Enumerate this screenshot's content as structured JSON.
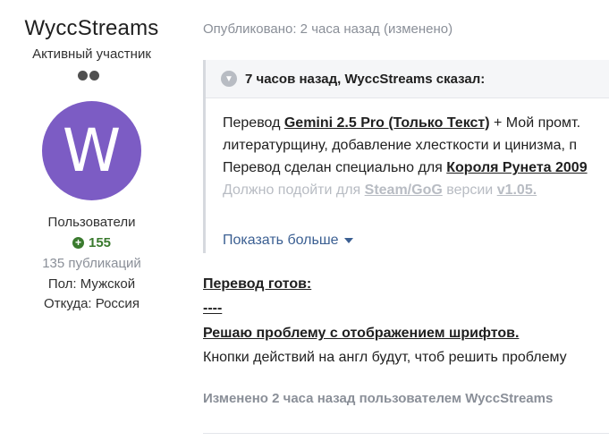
{
  "author": {
    "username": "WyccStreams",
    "rank": "Активный участник",
    "avatar_letter": "W",
    "avatar_color": "#7c5cc4",
    "group": "Пользователи",
    "reputation": "155",
    "posts": "135 публикаций",
    "gender": "Пол: Мужской",
    "location": "Откуда: Россия"
  },
  "post": {
    "meta": "Опубликовано: 2 часа назад (изменено)",
    "quote": {
      "header": "7 часов назад, WyccStreams сказал:",
      "line1_prefix": "Перевод ",
      "line1_bold": "Gemini 2.5 Pro (Только Текст)",
      "line1_suffix": " + Мой промт.",
      "line2": "литературщину, добавление хлесткости и цинизма, п",
      "line3_prefix": "Перевод сделан специально для ",
      "line3_bold": "Короля Рунета 2009",
      "line4_prefix": "Должно подойти для ",
      "line4_bold1": "Steam/GoG",
      "line4_mid": " версии ",
      "line4_bold2": "v1.05.",
      "show_more": "Показать больше"
    },
    "line_ready": "Перевод готов:",
    "line_dashes": "----",
    "line_fonts": "Решаю проблему с отображением шрифтов.",
    "line_buttons": "Кнопки действий на англ будут, чтоб решить проблему",
    "edited": "Изменено 2 часа назад пользователем WyccStreams"
  }
}
